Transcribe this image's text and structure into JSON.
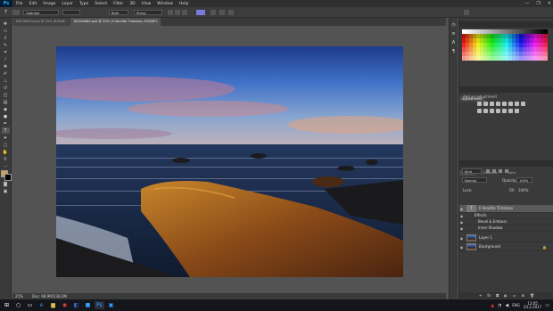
{
  "app": {
    "logo": "Ps"
  },
  "menu": [
    "File",
    "Edit",
    "Image",
    "Layer",
    "Type",
    "Select",
    "Filter",
    "3D",
    "View",
    "Window",
    "Help"
  ],
  "window_controls": [
    "—",
    "❐",
    "✕"
  ],
  "options": {
    "font_family": "Gabriola",
    "font_style": "Bold",
    "anti_alias": "Sharp"
  },
  "tabs": [
    {
      "label": "DSC06454.psd @ 25% (RGB/8)",
      "active": false
    },
    {
      "label": "DSC06464.psd @ 25% (Il Vendite Tintoloso, RGB/8*)",
      "active": true
    }
  ],
  "status": {
    "zoom": "25%",
    "doc": "Doc: 68,9M/138,0M"
  },
  "swatches_panel": {
    "tabs": [
      "Color",
      "Swatches",
      "Paths"
    ],
    "active": "Swatches"
  },
  "adjustments_panel": {
    "tabs": [
      "Adjustments"
    ],
    "subtitle": "Add an adjustment"
  },
  "layers_panel": {
    "tabs": [
      "Layers",
      "Channels",
      "Paths"
    ],
    "kind": "Kind",
    "blend": "Normal",
    "opacity_label": "Opacity:",
    "opacity": "100%",
    "lock_label": "Lock:",
    "fill_label": "Fill:",
    "fill": "100%",
    "layers": [
      {
        "name": "Il Vendite Tintoloso",
        "kind": "text",
        "selected": true
      },
      {
        "name": "Effects",
        "kind": "effect"
      },
      {
        "name": "Bevel & Emboss",
        "kind": "effect-item"
      },
      {
        "name": "Inner Shadow",
        "kind": "effect-item"
      },
      {
        "name": "Layer 1",
        "kind": "image"
      },
      {
        "name": "Background",
        "kind": "image"
      }
    ]
  },
  "taskbar": {
    "lang": "ENG",
    "time": "13:05",
    "date": "20.2.2017"
  }
}
